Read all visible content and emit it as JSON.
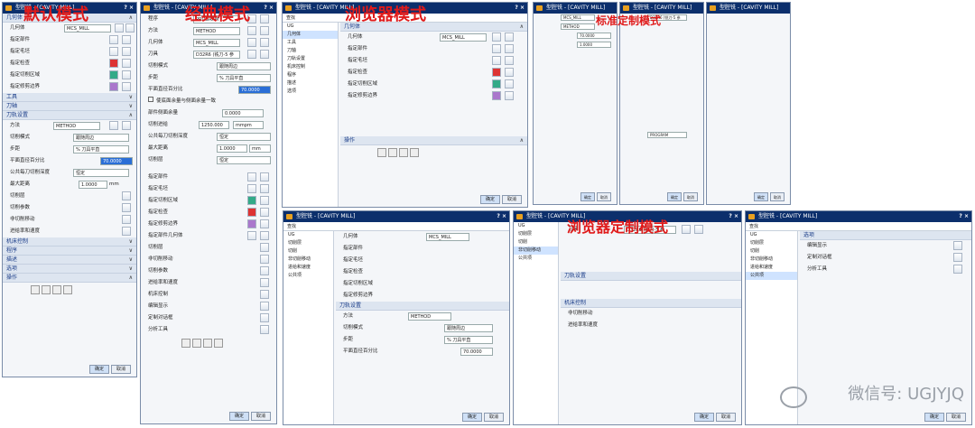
{
  "labels": {
    "default_mode": "默认模式",
    "classic_mode": "经典模式",
    "browser_mode": "浏览器模式",
    "standard_custom_mode": "标准定制模式",
    "browser_custom_mode": "浏览器定制模式"
  },
  "dialog": {
    "title": "型腔铣 - [CAVITY MILL]",
    "ok": "确定",
    "cancel": "取消",
    "search_label": "查找"
  },
  "default_panel": {
    "geometry_header": "几何体",
    "geometry_label": "几何体",
    "geometry_value": "MCS_MILL",
    "items": [
      "指定部件",
      "指定毛坯",
      "指定检查",
      "指定切削区域",
      "指定修剪边界"
    ],
    "tool_header": "工具",
    "axis_header": "刀轴",
    "path_header": "刀轨设置",
    "method_label": "方法",
    "method_value": "METHOD",
    "cut_mode_label": "切削模式",
    "cut_mode_value": "跟随周边",
    "stepover_label": "步距",
    "stepover_value": "% 刀具平直",
    "flat_pct_label": "平面直径百分比",
    "flat_pct_value": "70.0000",
    "common_depth_label": "公共每刀切削深度",
    "common_depth_value": "恒定",
    "max_dist_label": "最大距离",
    "max_dist_value": "1.0000",
    "max_dist_unit": "mm",
    "sub": [
      "切削层",
      "切削参数",
      "非切削移动",
      "进给率和速度"
    ],
    "machine_header": "机床控制",
    "program_header": "程序",
    "desc_header": "描述",
    "options_header": "选项",
    "actions_header": "操作"
  },
  "classic_panel": {
    "program_label": "程序",
    "program_value": "PROGRAM",
    "method_label": "方法",
    "method_value": "METHOD",
    "geometry_label": "几何体",
    "geometry_value": "MCS_MILL",
    "tool_label": "刀具",
    "tool_value": "D32R6 (铣刀-5 参",
    "cut_mode_label": "切削模式",
    "cut_mode_value": "跟随周边",
    "stepover_label": "步距",
    "stepover_value": "% 刀具平直",
    "flat_pct_label": "平面直径百分比",
    "flat_pct_value": "70.0000",
    "check_label": "使底面余量与侧面余量一致",
    "stock_label": "部件侧面余量",
    "stock_value": "0.0000",
    "feed_label": "切削进给",
    "feed_value": "1250.000",
    "feed_unit": "mmpm",
    "depth_label": "公共每刀切削深度",
    "depth_value": "恒定",
    "maxd_label": "最大距离",
    "maxd_value": "1.0000",
    "maxd_unit": "mm",
    "layers_label": "切削层",
    "layers_value": "恒定",
    "items": [
      "指定部件",
      "指定毛坯",
      "指定切削区域",
      "指定检查",
      "指定修剪边界",
      "指定部件几何体",
      "切削层",
      "非切削移动",
      "切削参数",
      "进给率和速度",
      "机床控制",
      "编辑显示",
      "定制对话框",
      "分析工具"
    ]
  },
  "browser_panel": {
    "tree": [
      "UG",
      "几何体",
      "工具",
      "刀轴",
      "刀轨设置",
      "机床控制",
      "程序",
      "描述",
      "选项"
    ],
    "geometry_header": "几何体",
    "geometry_label": "几何体",
    "geometry_value": "MCS_MILL",
    "items": [
      "指定部件",
      "指定毛坯",
      "指定检查",
      "指定切削区域",
      "指定修剪边界"
    ],
    "actions_header": "操作"
  },
  "std_custom": {
    "tool_value": "D32R6 (铣刀-5 参",
    "program_value": "PROGRAM",
    "method_value": "METHOD",
    "flat_value": "70.0000",
    "maxd_value": "1.0000"
  },
  "browser_custom": {
    "tree": [
      "UG",
      "切削层",
      "切削",
      "非切削移动",
      "进给和速度",
      "公共项"
    ],
    "tool_label": "刀具",
    "tool_value": "D32R6 (铣刀-5 参",
    "path_header": "刀轨设置",
    "machine_header": "机床控制",
    "sub": [
      "几何体",
      "切削层",
      "选项",
      "分析工具"
    ],
    "method_value": "METHOD",
    "cut_mode_value": "跟随周边",
    "stepover_value": "% 刀具平直",
    "flat_value": "70.0000",
    "depth_value": "恒定",
    "maxd_value": "1.0000"
  },
  "watermark": "微信号: UGJYJQ"
}
